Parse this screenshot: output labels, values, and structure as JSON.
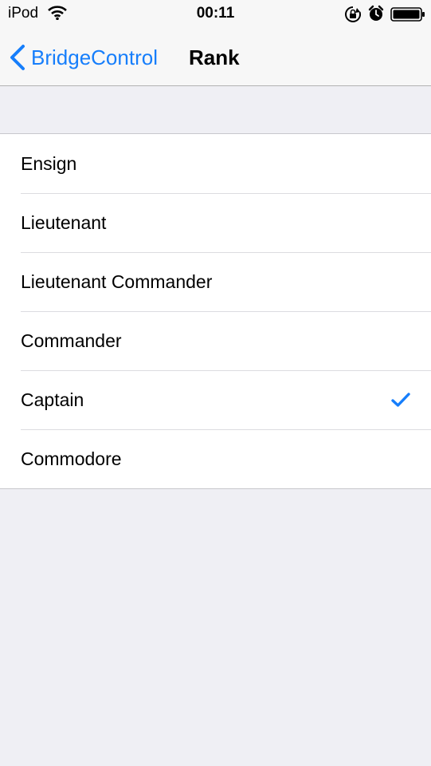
{
  "status_bar": {
    "carrier": "iPod",
    "time": "00:11",
    "icons": [
      "wifi-icon",
      "rotation-lock-icon",
      "alarm-icon",
      "battery-icon"
    ]
  },
  "nav_bar": {
    "back_label": "BridgeControl",
    "title": "Rank"
  },
  "ranks": {
    "items": [
      {
        "label": "Ensign",
        "selected": false
      },
      {
        "label": "Lieutenant",
        "selected": false
      },
      {
        "label": "Lieutenant Commander",
        "selected": false
      },
      {
        "label": "Commander",
        "selected": false
      },
      {
        "label": "Captain",
        "selected": true
      },
      {
        "label": "Commodore",
        "selected": false
      }
    ]
  },
  "colors": {
    "accent": "#167efb",
    "background": "#efeff4",
    "nav_background": "#f7f7f7"
  }
}
